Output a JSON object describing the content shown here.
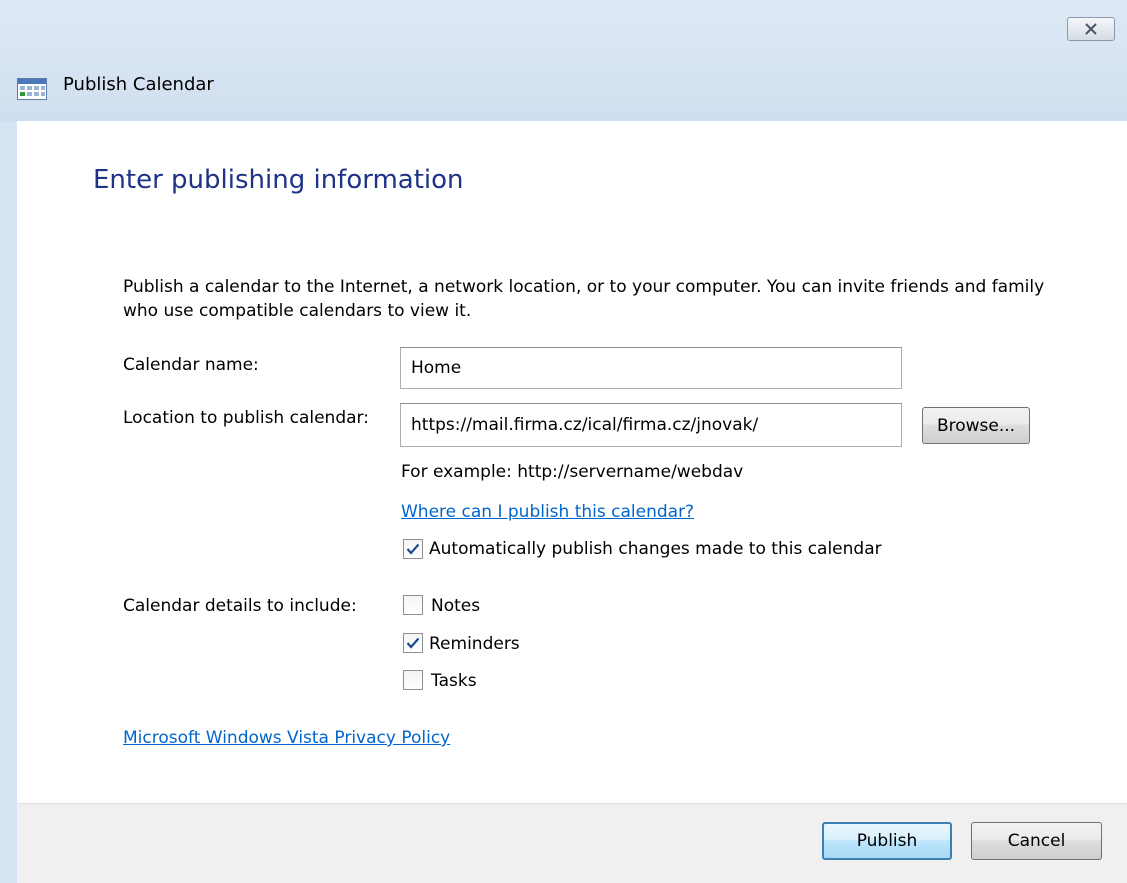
{
  "window": {
    "title": "Publish Calendar",
    "close_symbol": "✕"
  },
  "page": {
    "heading": "Enter publishing information",
    "description": "Publish a calendar to the Internet, a network location, or to your computer. You can invite friends and family who use compatible calendars to view it."
  },
  "form": {
    "calendar_name_label": "Calendar name:",
    "calendar_name_value": "Home",
    "location_label": "Location to publish calendar:",
    "location_value": "https://mail.firma.cz/ical/firma.cz/jnovak/",
    "browse_label": "Browse...",
    "example_text": "For example: http://servername/webdav",
    "where_link": "Where can I publish this calendar?",
    "auto_publish_label": "Automatically publish changes made to this calendar",
    "auto_publish_checked": true,
    "details_label": "Calendar details to include:",
    "details": [
      {
        "label": "Notes",
        "checked": false
      },
      {
        "label": "Reminders",
        "checked": true
      },
      {
        "label": "Tasks",
        "checked": false
      }
    ]
  },
  "privacy_link": "Microsoft Windows Vista Privacy Policy",
  "footer": {
    "publish_label": "Publish",
    "cancel_label": "Cancel"
  },
  "colors": {
    "heading": "#1e3287",
    "link": "#0066cc",
    "titlebar": "#d6e3f2"
  },
  "icons": [
    "calendar-icon",
    "close-icon",
    "checkmark-icon"
  ]
}
